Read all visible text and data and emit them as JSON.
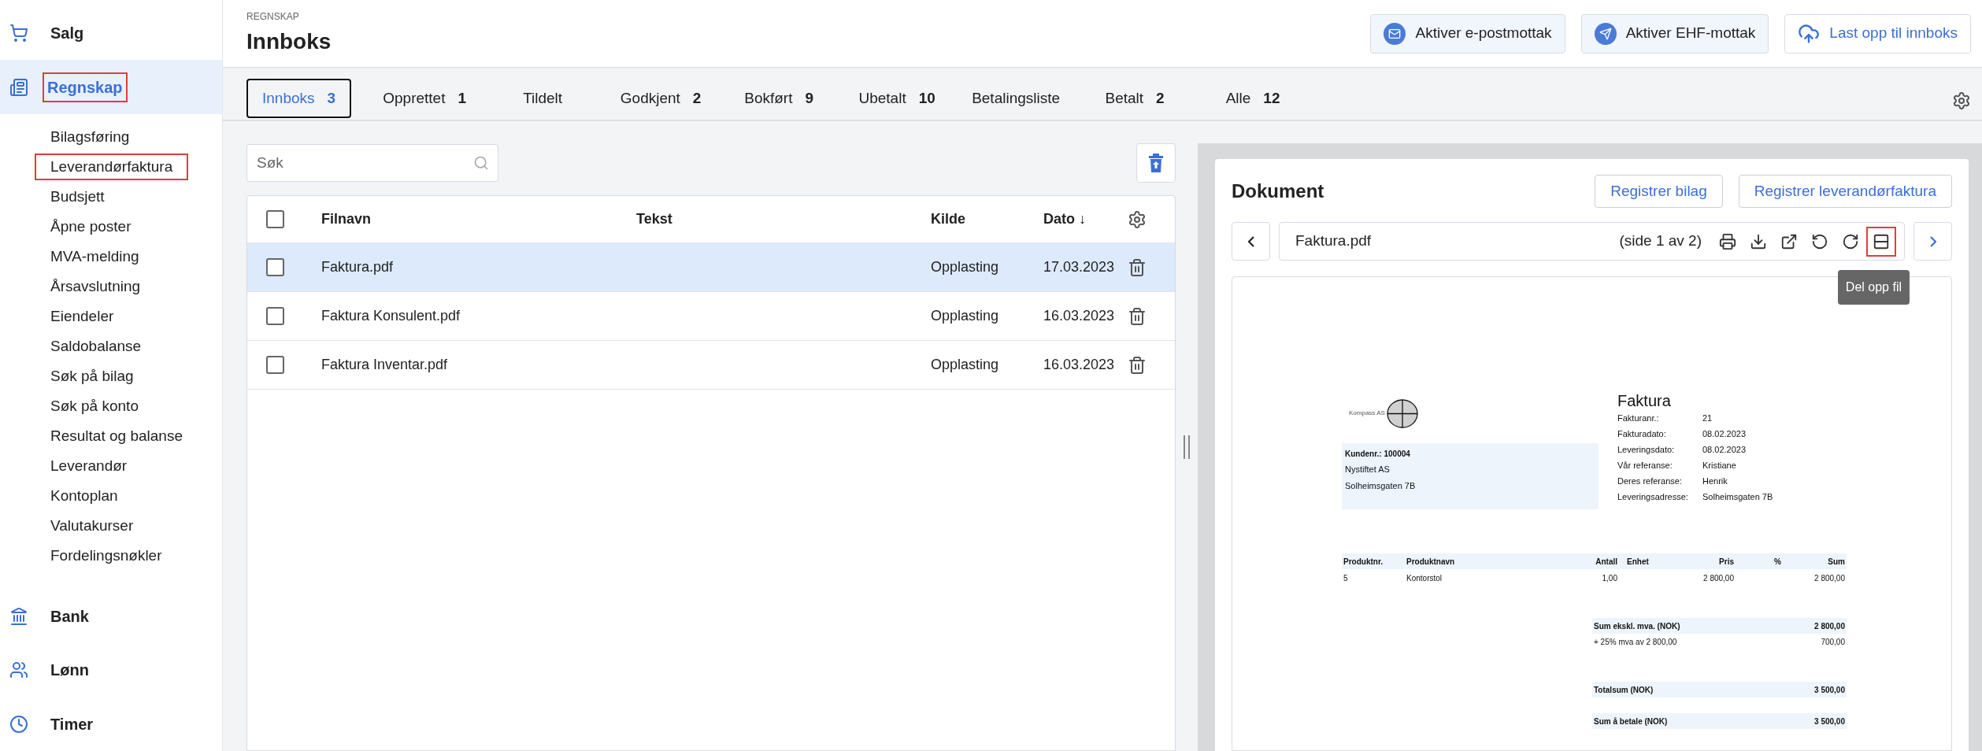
{
  "sidebar": {
    "sections": [
      {
        "label": "Salg",
        "kind": "cart",
        "selected": false,
        "highlighted": false
      },
      {
        "label": "Regnskap",
        "kind": "ledger",
        "selected": true,
        "highlighted": true,
        "children": [
          {
            "label": "Bilagsføring",
            "highlighted": false
          },
          {
            "label": "Leverandørfaktura",
            "highlighted": true
          },
          {
            "label": "Budsjett",
            "highlighted": false
          },
          {
            "label": "Åpne poster",
            "highlighted": false
          },
          {
            "label": "MVA-melding",
            "highlighted": false
          },
          {
            "label": "Årsavslutning",
            "highlighted": false
          },
          {
            "label": "Eiendeler",
            "highlighted": false
          },
          {
            "label": "Saldobalanse",
            "highlighted": false
          },
          {
            "label": "Søk på bilag",
            "highlighted": false
          },
          {
            "label": "Søk på konto",
            "highlighted": false
          },
          {
            "label": "Resultat og balanse",
            "highlighted": false
          },
          {
            "label": "Leverandør",
            "highlighted": false
          },
          {
            "label": "Kontoplan",
            "highlighted": false
          },
          {
            "label": "Valutakurser",
            "highlighted": false
          },
          {
            "label": "Fordelingsnøkler",
            "highlighted": false
          }
        ]
      },
      {
        "label": "Bank",
        "kind": "bank",
        "selected": false,
        "highlighted": false
      },
      {
        "label": "Lønn",
        "kind": "people",
        "selected": false,
        "highlighted": false
      },
      {
        "label": "Timer",
        "kind": "clock",
        "selected": false,
        "highlighted": false
      }
    ]
  },
  "header": {
    "breadcrumb": "REGNSKAP",
    "title": "Innboks",
    "buttons": [
      {
        "label": "Aktiver e-postmottak",
        "kind": "mail"
      },
      {
        "label": "Aktiver EHF-mottak",
        "kind": "send"
      },
      {
        "label": "Last opp til innboks",
        "kind": "upload"
      }
    ]
  },
  "tabs": [
    {
      "label": "Innboks",
      "count": "3",
      "selected": true
    },
    {
      "label": "Opprettet",
      "count": "1",
      "selected": false
    },
    {
      "label": "Tildelt",
      "selected": false
    },
    {
      "label": "Godkjent",
      "count": "2",
      "selected": false
    },
    {
      "label": "Bokført",
      "count": "9",
      "selected": false
    },
    {
      "label": "Ubetalt",
      "count": "10",
      "selected": false
    },
    {
      "label": "Betalingsliste",
      "selected": false
    },
    {
      "label": "Betalt",
      "count": "2",
      "selected": false
    },
    {
      "label": "Alle",
      "count": "12",
      "selected": false
    }
  ],
  "search": {
    "placeholder": "Søk"
  },
  "table": {
    "columns": [
      "Filnavn",
      "Tekst",
      "Kilde",
      "Dato ↓"
    ],
    "header_checked": false,
    "rows": [
      {
        "filnavn": "Faktura.pdf",
        "kilde": "Opplasting",
        "dato": "17.03.2023",
        "selected": true,
        "checked": false
      },
      {
        "filnavn": "Faktura Konsulent.pdf",
        "kilde": "Opplasting",
        "dato": "16.03.2023",
        "selected": false,
        "checked": false
      },
      {
        "filnavn": "Faktura Inventar.pdf",
        "kilde": "Opplasting",
        "dato": "16.03.2023",
        "selected": false,
        "checked": false
      }
    ]
  },
  "document": {
    "title": "Dokument",
    "buttons": [
      "Registrer bilag",
      "Registrer leverandørfaktura"
    ],
    "file_name": "Faktura.pdf",
    "page_info": "(side 1 av 2)",
    "tools": [
      {
        "kind": "print",
        "highlighted": false
      },
      {
        "kind": "download",
        "highlighted": false
      },
      {
        "kind": "open",
        "highlighted": false
      },
      {
        "kind": "rotate_left",
        "highlighted": false
      },
      {
        "kind": "rotate_right",
        "highlighted": false
      },
      {
        "kind": "split",
        "highlighted": true
      }
    ],
    "tooltip": "Del opp fil",
    "invoice": {
      "company": "Kompass AS",
      "title": "Faktura",
      "details": [
        {
          "label": "Fakturanr.:",
          "value": "21"
        },
        {
          "label": "Fakturadato:",
          "value": "08.02.2023"
        },
        {
          "label": "Leveringsdato:",
          "value": "08.02.2023"
        },
        {
          "label": "Vår referanse:",
          "value": "Kristiane"
        },
        {
          "label": "Deres referanse:",
          "value": "Henrik"
        },
        {
          "label": "Leveringsadresse:",
          "value": "Solheimsgaten 7B"
        }
      ],
      "customer": {
        "number": "Kundenr.: 100004",
        "name": "Nystiftet AS",
        "address": "Solheimsgaten 7B"
      },
      "columns": [
        "Produktnr.",
        "Produktnavn",
        "Antall",
        "Enhet",
        "Pris",
        "%",
        "Sum"
      ],
      "lines": [
        {
          "produktnr": "5",
          "produktnavn": "Kontorstol",
          "antall": "1,00",
          "pris": "2 800,00",
          "sum": "2 800,00"
        }
      ],
      "totals": [
        {
          "label": "Sum ekskl. mva. (NOK)",
          "value": "2 800,00",
          "bold": true
        },
        {
          "label": "+ 25% mva av 2 800,00",
          "value": "700,00",
          "bold": false
        },
        {
          "label": "Totalsum (NOK)",
          "value": "3 500,00",
          "bold": true
        },
        {
          "label": "Sum å betale (NOK)",
          "value": "3 500,00",
          "bold": true
        }
      ]
    }
  }
}
